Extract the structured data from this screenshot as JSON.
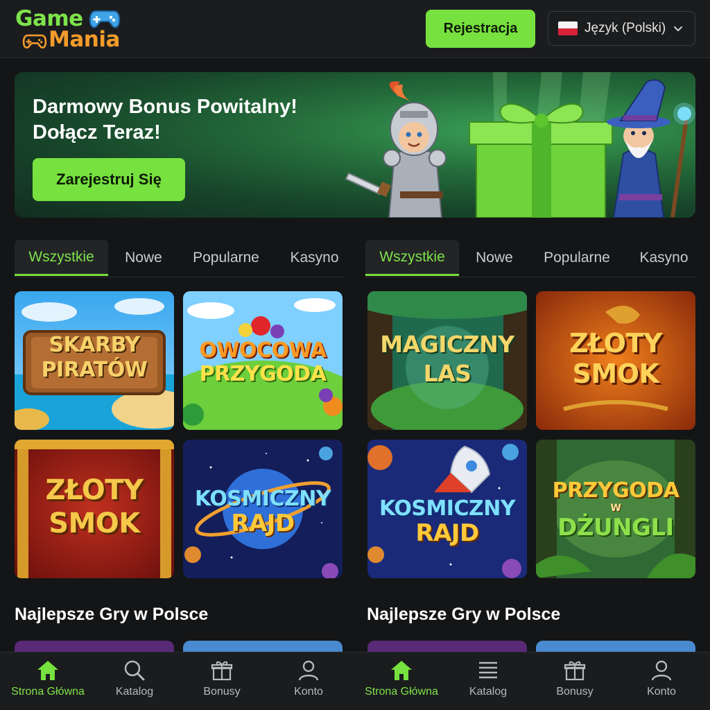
{
  "brand": {
    "logo_line1": "Game",
    "logo_line2": "Mania",
    "accent": "#76e13f",
    "logo_orange": "#f29b2b"
  },
  "header": {
    "register_label": "Rejestracja",
    "language_label": "Język (Polski)",
    "language_flag": "flag-poland"
  },
  "banner": {
    "title": "Darmowy Bonus Powitalny!\nDołącz Teraz!",
    "cta_label": "Zarejestruj Się"
  },
  "columns": [
    {
      "tabs": [
        {
          "label": "Wszystkie",
          "active": true
        },
        {
          "label": "Nowe",
          "active": false
        },
        {
          "label": "Popularne",
          "active": false
        },
        {
          "label": "Kasyno",
          "active": false
        }
      ],
      "games": [
        {
          "line1": "SKARBY",
          "line2": "PIRATÓW"
        },
        {
          "line1": "OWOCOWA",
          "line2": "PRZYGODA"
        },
        {
          "line1": "ZŁOTY",
          "line2": "SMOK"
        },
        {
          "line1": "KOSMICZNY",
          "line2": "RAJD"
        }
      ],
      "section_title": "Najlepsze Gry w Polsce"
    },
    {
      "tabs": [
        {
          "label": "Wszystkie",
          "active": true
        },
        {
          "label": "Nowe",
          "active": false
        },
        {
          "label": "Popularne",
          "active": false
        },
        {
          "label": "Kasyno",
          "active": false
        }
      ],
      "games": [
        {
          "line1": "MAGICZNY",
          "line2": "LAS"
        },
        {
          "line1": "ZŁOTY",
          "line2": "SMOK"
        },
        {
          "line1": "KOSMICZNY",
          "line2": "RAJD"
        },
        {
          "line1": "PRZYGODA",
          "line_mid": "W",
          "line2": "DŻUNGLI"
        }
      ],
      "section_title": "Najlepsze Gry w Polsce"
    }
  ],
  "bottom_nav": {
    "left": [
      {
        "label": "Strona Główna",
        "icon": "home-icon",
        "active": true
      },
      {
        "label": "Katalog",
        "icon": "search-icon",
        "active": false
      },
      {
        "label": "Bonusy",
        "icon": "gift-icon",
        "active": false
      },
      {
        "label": "Konto",
        "icon": "user-icon",
        "active": false
      }
    ],
    "right": [
      {
        "label": "Strona Główna",
        "icon": "home-icon",
        "active": true
      },
      {
        "label": "Katalog",
        "icon": "menu-icon",
        "active": false
      },
      {
        "label": "Bonusy",
        "icon": "gift-icon",
        "active": false
      },
      {
        "label": "Konto",
        "icon": "user-icon",
        "active": false
      }
    ]
  }
}
